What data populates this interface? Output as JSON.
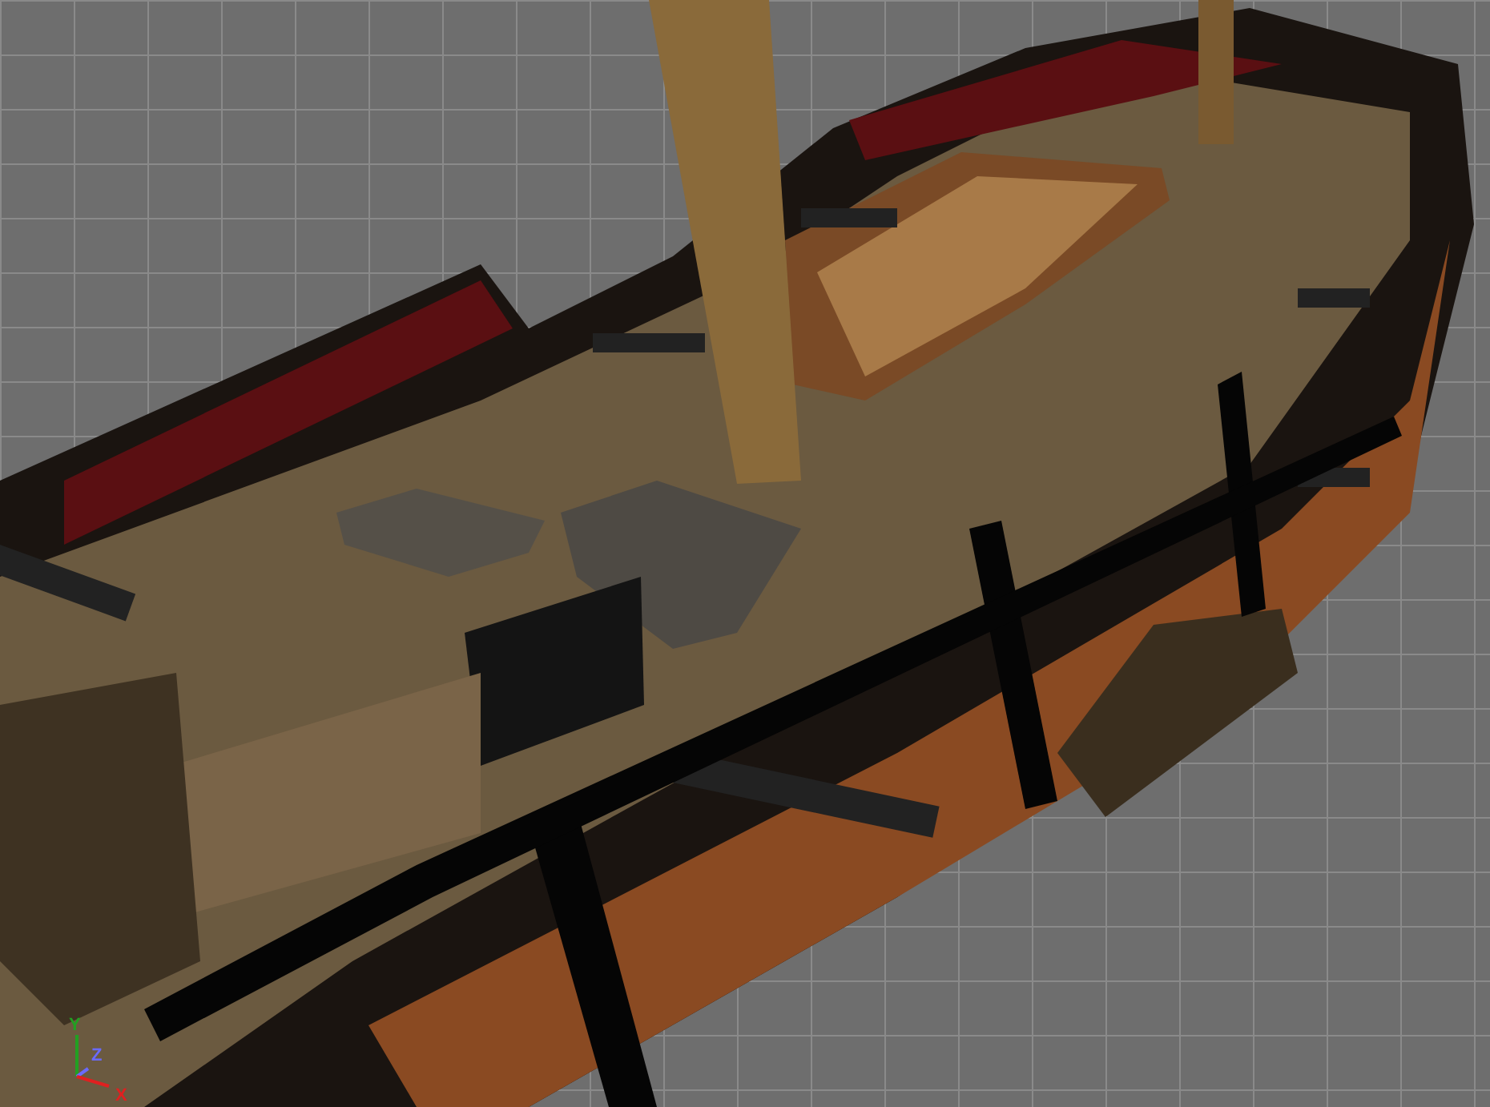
{
  "viewport": {
    "axes": [
      {
        "label": "Y",
        "color": "#22a022"
      },
      {
        "label": "Z",
        "color": "#6a6aff"
      },
      {
        "label": "X",
        "color": "#e02020"
      }
    ]
  }
}
